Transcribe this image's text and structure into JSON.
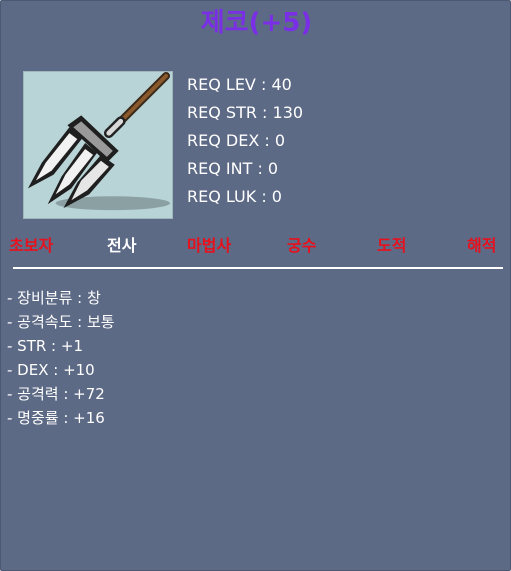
{
  "item": {
    "name": "제코(+5)",
    "icon": "trident-spear-icon"
  },
  "requirements": [
    "REQ LEV : 40",
    "REQ STR : 130",
    "REQ DEX : 0",
    "REQ INT : 0",
    "REQ LUK : 0"
  ],
  "jobs": [
    {
      "label": "초보자",
      "enabled": false
    },
    {
      "label": "전사",
      "enabled": true
    },
    {
      "label": "마법사",
      "enabled": false
    },
    {
      "label": "궁수",
      "enabled": false
    },
    {
      "label": "도적",
      "enabled": false
    },
    {
      "label": "해적",
      "enabled": false
    }
  ],
  "stats": [
    "- 장비분류 : 창",
    "- 공격속도 : 보통",
    "- STR : +1",
    "- DEX : +10",
    "- 공격력 : +72",
    "- 명중률 : +16"
  ],
  "colors": {
    "background": "#5d6a86",
    "title": "#7a2fe6",
    "job_disabled": "#e8101c",
    "job_enabled": "#ffffff",
    "text": "#ffffff",
    "icon_background": "#b9d4d7"
  }
}
